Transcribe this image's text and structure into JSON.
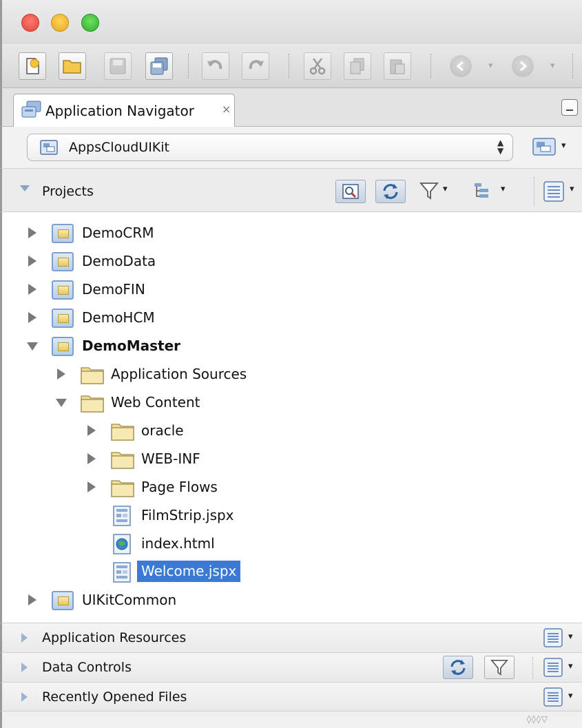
{
  "navigator_tab": {
    "label": "Application Navigator",
    "close_glyph": "×"
  },
  "application_selector": {
    "value": "AppsCloudUIKit",
    "arrows": "▲▼"
  },
  "projects_panel": {
    "title": "Projects"
  },
  "tree": {
    "projects": [
      {
        "label": "DemoCRM"
      },
      {
        "label": "DemoData"
      },
      {
        "label": "DemoFIN"
      },
      {
        "label": "DemoHCM"
      },
      {
        "label": "DemoMaster"
      }
    ],
    "demomaster_children": [
      {
        "label": "Application Sources"
      },
      {
        "label": "Web Content"
      }
    ],
    "web_content_children": [
      {
        "label": "oracle"
      },
      {
        "label": "WEB-INF"
      },
      {
        "label": "Page Flows"
      },
      {
        "label": "FilmStrip.jspx"
      },
      {
        "label": "index.html"
      },
      {
        "label": "Welcome.jspx"
      }
    ],
    "last_project": {
      "label": "UIKitCommon"
    }
  },
  "accordions": [
    {
      "title": "Application Resources"
    },
    {
      "title": "Data Controls"
    },
    {
      "title": "Recently Opened Files"
    }
  ],
  "colors": {
    "selection": "#3a79d6",
    "window_close": "#e0443a",
    "window_minimize": "#e9a91e",
    "window_zoom": "#2fae2a"
  },
  "icons": {
    "toolbar": [
      "new-file-icon",
      "open-folder-icon",
      "save-icon",
      "save-all-icon",
      "undo-icon",
      "redo-icon",
      "cut-icon",
      "copy-icon",
      "paste-icon",
      "back-icon",
      "forward-icon"
    ],
    "projects_header": [
      "find-icon",
      "sync-icon",
      "filter-icon",
      "tree-options-icon",
      "panel-menu-icon"
    ]
  }
}
